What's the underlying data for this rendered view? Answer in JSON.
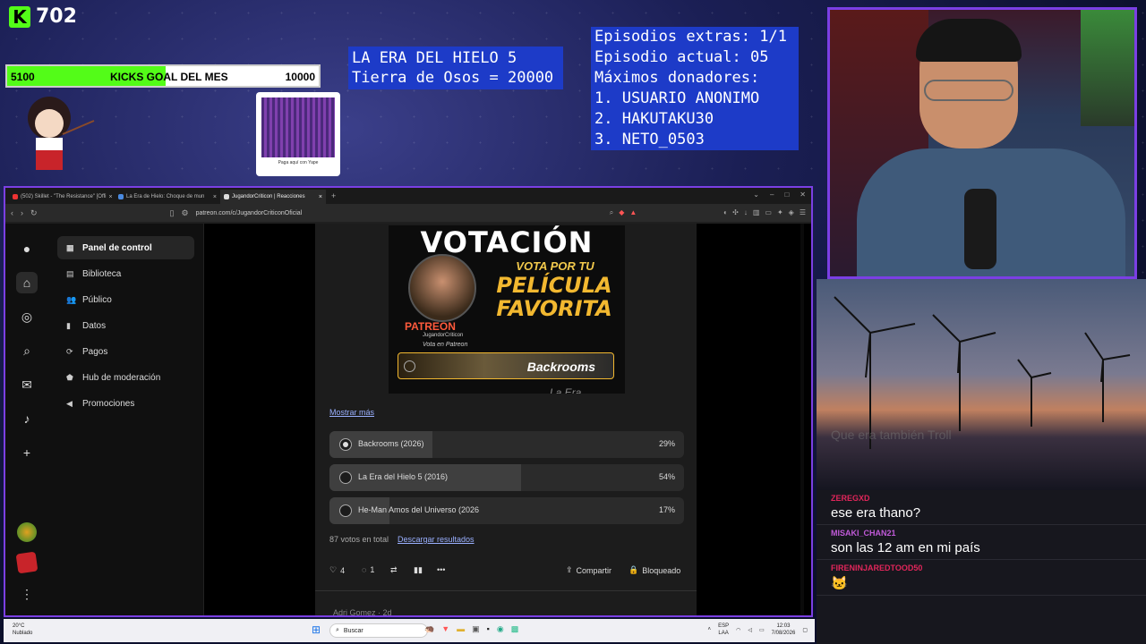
{
  "stream": {
    "kick_count": "702",
    "goal": {
      "start": "5100",
      "title": "KICKS GOAL DEL MES",
      "end": "10000",
      "progress": 0.51
    },
    "qr_caption": "Paga aquí con Yape",
    "ice_age_lines": [
      "LA ERA DEL HIELO 5",
      "Tierra de Osos = 20000"
    ],
    "info_lines": [
      "Episodios extras: 1/1",
      "Episodio actual: 05",
      "Máximos donadores:",
      "1. USUARIO ANONIMO",
      "2. HAKUTAKU30",
      "3. NETO_0503"
    ]
  },
  "chat": {
    "ghost": "Que era también Troll",
    "messages": [
      {
        "user": "ZEREGXD",
        "text": "ese era thano?",
        "color": "#e0265a"
      },
      {
        "user": "MISAKI_CHAN21",
        "text": "son las 12 am en mi país",
        "color": "#c05ad8"
      },
      {
        "user": "FIRENINJAREDTOOD50",
        "text": "",
        "color": "#e0265a"
      }
    ]
  },
  "browser": {
    "tabs": [
      {
        "label": "(502) Skillet - \"The Resistance\" [Offi",
        "color": "#e33"
      },
      {
        "label": "La Era de Hielo: Choque de mun",
        "color": "#4a8ae0"
      },
      {
        "label": "JugandorCriticon | Reacciones",
        "color": "#ddd"
      }
    ],
    "url": "patreon.com/c/JugandorCriticonOficial"
  },
  "nav": {
    "items": [
      {
        "label": "Panel de control",
        "icon": "▦"
      },
      {
        "label": "Biblioteca",
        "icon": "▤"
      },
      {
        "label": "Público",
        "icon": "👥"
      },
      {
        "label": "Datos",
        "icon": "▮"
      },
      {
        "label": "Pagos",
        "icon": "⟳"
      },
      {
        "label": "Hub de moderación",
        "icon": "⬟"
      },
      {
        "label": "Promociones",
        "icon": "◀"
      }
    ]
  },
  "post": {
    "poster": {
      "title": "VOTACIÓN",
      "vota": "VOTA POR TU",
      "peli": "PELÍCULA FAVORITA",
      "patreon": "PATREON",
      "creator": "JugandorCriticon",
      "vota_en": "Vota en Patreon",
      "option1": "Backrooms",
      "option2": "La Era"
    },
    "show_more": "Mostrar más",
    "poll": [
      {
        "label": "Backrooms (2026)",
        "pct": "29%",
        "value": 29,
        "selected": true
      },
      {
        "label": "La Era del Hielo 5 (2016)",
        "pct": "54%",
        "value": 54,
        "selected": false
      },
      {
        "label": "He-Man Amos del Universo (2026",
        "pct": "17%",
        "value": 17,
        "selected": false
      }
    ],
    "votes": "87 votos en total",
    "download": "Descargar resultados",
    "likes": "4",
    "comments": "1",
    "share": "Compartir",
    "locked": "Bloqueado",
    "next_comment": "Adri Gomez · 2d"
  },
  "taskbar": {
    "temp": "20°C",
    "weather": "Nublado",
    "search": "Buscar",
    "lang": "ESP",
    "lang2": "LAA",
    "time": "12:03",
    "date": "7/08/2026"
  }
}
